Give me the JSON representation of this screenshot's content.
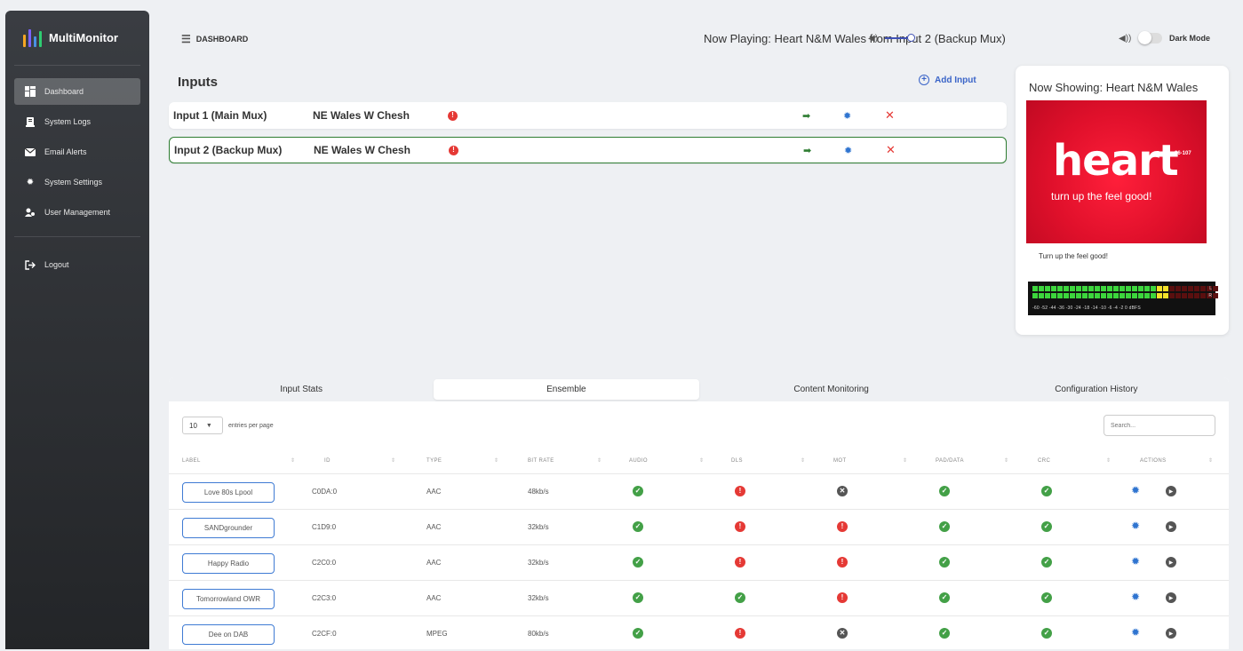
{
  "app": {
    "name": "MultiMonitor"
  },
  "sidebar": {
    "items": [
      {
        "label": "Dashboard",
        "icon": "dashboard-icon",
        "active": true
      },
      {
        "label": "System Logs",
        "icon": "logs-icon"
      },
      {
        "label": "Email Alerts",
        "icon": "envelope-icon"
      },
      {
        "label": "System Settings",
        "icon": "gear-icon"
      },
      {
        "label": "User Management",
        "icon": "users-icon"
      }
    ],
    "logout": "Logout"
  },
  "topbar": {
    "page": "DASHBOARD",
    "now_playing": "Now Playing: Heart N&M Wales from Input 2 (Backup Mux)",
    "dark_mode": "Dark Mode"
  },
  "inputs": {
    "title": "Inputs",
    "add_label": "Add Input",
    "rows": [
      {
        "name": "Input 1 (Main Mux)",
        "mux": "NE Wales W Chesh",
        "status": "error",
        "selected": false
      },
      {
        "name": "Input 2 (Backup Mux)",
        "mux": "NE Wales W Chesh",
        "status": "error",
        "selected": true
      }
    ]
  },
  "now_showing": {
    "title": "Now Showing: Heart N&M Wales",
    "slide_logo": "heart",
    "slide_freq": "96-107",
    "slide_tagline": "turn up the feel good!",
    "dls_text": "Turn up the feel good!",
    "meter_scale": "-60  -52  -44  -36  -30  -24  -18  -14  -10  -6   -4   -2   0  dBFS",
    "meter_channels": [
      "L",
      "R"
    ],
    "colors": {
      "green": "#3cd63c",
      "yellow": "#f5e12a",
      "dim_red": "#5a0f0f"
    }
  },
  "tabs": [
    "Input Stats",
    "Ensemble",
    "Content Monitoring",
    "Configuration History"
  ],
  "active_tab": 1,
  "table": {
    "entries_value": "10",
    "entries_label": "entries per page",
    "search_placeholder": "Search...",
    "headers": [
      "LABEL",
      "ID",
      "TYPE",
      "BIT RATE",
      "AUDIO",
      "DLS",
      "MOT",
      "PAD/DATA",
      "CRC",
      "ACTIONS"
    ],
    "rows": [
      {
        "label": "Love 80s Lpool",
        "id": "C0DA:0",
        "type": "AAC",
        "bitrate": "48kb/s",
        "audio": "ok",
        "dls": "error",
        "mot": "off",
        "pad": "ok",
        "crc": "ok"
      },
      {
        "label": "SANDgrounder",
        "id": "C1D9:0",
        "type": "AAC",
        "bitrate": "32kb/s",
        "audio": "ok",
        "dls": "error",
        "mot": "error",
        "pad": "ok",
        "crc": "ok"
      },
      {
        "label": "Happy Radio",
        "id": "C2C0:0",
        "type": "AAC",
        "bitrate": "32kb/s",
        "audio": "ok",
        "dls": "error",
        "mot": "error",
        "pad": "ok",
        "crc": "ok"
      },
      {
        "label": "Tomorrowland OWR",
        "id": "C2C3:0",
        "type": "AAC",
        "bitrate": "32kb/s",
        "audio": "ok",
        "dls": "ok",
        "mot": "error",
        "pad": "ok",
        "crc": "ok"
      },
      {
        "label": "Dee on DAB",
        "id": "C2CF:0",
        "type": "MPEG",
        "bitrate": "80kb/s",
        "audio": "ok",
        "dls": "error",
        "mot": "off",
        "pad": "ok",
        "crc": "ok"
      }
    ]
  }
}
